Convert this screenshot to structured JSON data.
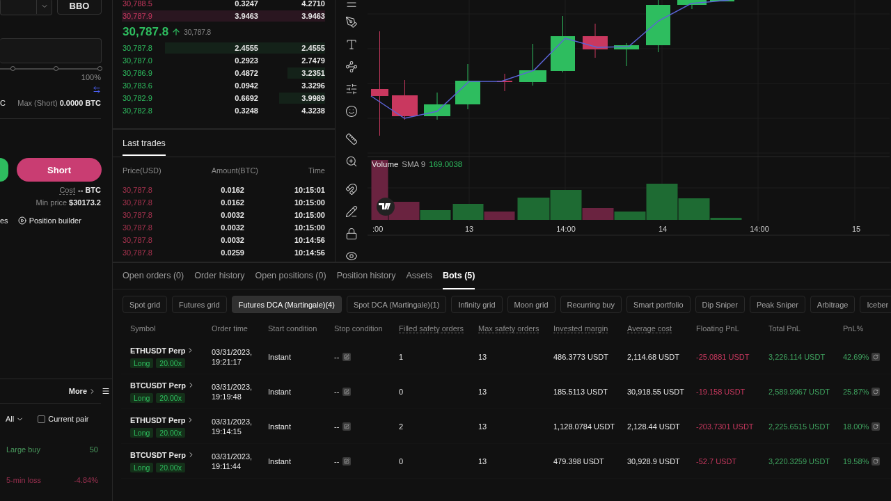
{
  "order_form": {
    "type_button": "BBO",
    "percent_label": "100%",
    "cut_left_text": "C",
    "max_short_label": "Max (Short)",
    "max_short_value": "0.0000 BTC",
    "short_button": "Short",
    "cost_label": "Cost",
    "cost_value": "-- BTC",
    "min_price_label": "Min price",
    "min_price_value": "$30173.2",
    "cut_link_text": "es",
    "position_builder": "Position builder"
  },
  "alerts_panel": {
    "more": "More",
    "filter": "All",
    "current_pair": {
      "label": "Current pair",
      "checked": false
    },
    "items": [
      {
        "label": "Large buy",
        "value": "50",
        "kind": "up"
      },
      {
        "label": "5-min loss",
        "value": "-4.84%",
        "kind": "down"
      }
    ]
  },
  "order_book": {
    "asks": [
      {
        "price": "30,788.5",
        "amount": "0.3247",
        "total": "4.2710"
      },
      {
        "price": "30,787.9",
        "amount": "3.9463",
        "total": "3.9463"
      }
    ],
    "last_price": "30,787.8",
    "mark_price": "30,787.8",
    "bids": [
      {
        "price": "30,787.8",
        "amount": "2.4555",
        "total": "2.4555"
      },
      {
        "price": "30,787.0",
        "amount": "0.2923",
        "total": "2.7479"
      },
      {
        "price": "30,786.9",
        "amount": "0.4872",
        "total": "3.2351"
      },
      {
        "price": "30,783.6",
        "amount": "0.0942",
        "total": "3.3296"
      },
      {
        "price": "30,782.9",
        "amount": "0.6692",
        "total": "3.9989"
      },
      {
        "price": "30,782.8",
        "amount": "0.3248",
        "total": "4.3238"
      }
    ]
  },
  "last_trades": {
    "title": "Last trades",
    "columns": [
      "Price(USD)",
      "Amount(BTC)",
      "Time"
    ],
    "rows": [
      {
        "price": "30,787.8",
        "amount": "0.0162",
        "time": "10:15:01"
      },
      {
        "price": "30,787.8",
        "amount": "0.0162",
        "time": "10:15:00"
      },
      {
        "price": "30,787.8",
        "amount": "0.0032",
        "time": "10:15:00"
      },
      {
        "price": "30,787.8",
        "amount": "0.0032",
        "time": "10:15:00"
      },
      {
        "price": "30,787.8",
        "amount": "0.0032",
        "time": "10:14:56"
      },
      {
        "price": "30,787.8",
        "amount": "0.0259",
        "time": "10:14:56"
      }
    ]
  },
  "chart": {
    "volume_label": "Volume",
    "sma_label": "SMA 9",
    "sma_value": "169.0038",
    "time_labels": [
      ":00",
      "13",
      "14:00",
      "14",
      "14:00",
      "15"
    ]
  },
  "tabs": [
    {
      "label": "Open orders (0)",
      "selected": false
    },
    {
      "label": "Order history",
      "selected": false
    },
    {
      "label": "Open positions (0)",
      "selected": false
    },
    {
      "label": "Position history",
      "selected": false
    },
    {
      "label": "Assets",
      "selected": false
    },
    {
      "label": "Bots (5)",
      "selected": true
    }
  ],
  "bot_types": [
    {
      "label": "Spot grid",
      "selected": false
    },
    {
      "label": "Futures grid",
      "selected": false
    },
    {
      "label": "Futures DCA (Martingale)(4)",
      "selected": true
    },
    {
      "label": "Spot DCA (Martingale)(1)",
      "selected": false
    },
    {
      "label": "Infinity grid",
      "selected": false
    },
    {
      "label": "Moon grid",
      "selected": false
    },
    {
      "label": "Recurring buy",
      "selected": false
    },
    {
      "label": "Smart portfolio",
      "selected": false
    },
    {
      "label": "Dip Sniper",
      "selected": false
    },
    {
      "label": "Peak Sniper",
      "selected": false
    },
    {
      "label": "Arbitrage",
      "selected": false
    },
    {
      "label": "Iceber",
      "selected": false
    }
  ],
  "table": {
    "columns": [
      {
        "label": "Symbol",
        "underlined": false
      },
      {
        "label": "Order time",
        "underlined": false
      },
      {
        "label": "Start condition",
        "underlined": false
      },
      {
        "label": "Stop condition",
        "underlined": false
      },
      {
        "label": "Filled safety orders",
        "underlined": true
      },
      {
        "label": "Max safety orders",
        "underlined": true
      },
      {
        "label": "Invested margin",
        "underlined": true
      },
      {
        "label": "Average cost",
        "underlined": true
      },
      {
        "label": "Floating PnL",
        "underlined": false
      },
      {
        "label": "Total PnL",
        "underlined": false
      },
      {
        "label": "PnL%",
        "underlined": false
      }
    ],
    "rows": [
      {
        "symbol": "ETHUSDT Perp",
        "side": "Long",
        "leverage": "20.00x",
        "order_time": "03/31/2023, 19:21:17",
        "start": "Instant",
        "stop": "--",
        "filled": "1",
        "max": "13",
        "invested": "486.3773 USDT",
        "average": "2,114.68 USDT",
        "floating": "-25.0881 USDT",
        "total": "3,226.114 USDT",
        "pnl_pct": "42.69%"
      },
      {
        "symbol": "BTCUSDT Perp",
        "side": "Long",
        "leverage": "20.00x",
        "order_time": "03/31/2023, 19:19:48",
        "start": "Instant",
        "stop": "--",
        "filled": "0",
        "max": "13",
        "invested": "185.5113 USDT",
        "average": "30,918.55 USDT",
        "floating": "-19.158 USDT",
        "total": "2,589.9967 USDT",
        "pnl_pct": "25.87%"
      },
      {
        "symbol": "ETHUSDT Perp",
        "side": "Long",
        "leverage": "20.00x",
        "order_time": "03/31/2023, 19:14:15",
        "start": "Instant",
        "stop": "--",
        "filled": "2",
        "max": "13",
        "invested": "1,128.0784 USDT",
        "average": "2,128.44 USDT",
        "floating": "-203.7301 USDT",
        "total": "2,225.6515 USDT",
        "pnl_pct": "18.00%"
      },
      {
        "symbol": "BTCUSDT Perp",
        "side": "Long",
        "leverage": "20.00x",
        "order_time": "03/31/2023, 19:11:44",
        "start": "Instant",
        "stop": "--",
        "filled": "0",
        "max": "13",
        "invested": "479.398 USDT",
        "average": "30,928.9 USDT",
        "floating": "-52.7 USDT",
        "total": "3,220.3259 USDT",
        "pnl_pct": "19.58%"
      }
    ]
  }
}
